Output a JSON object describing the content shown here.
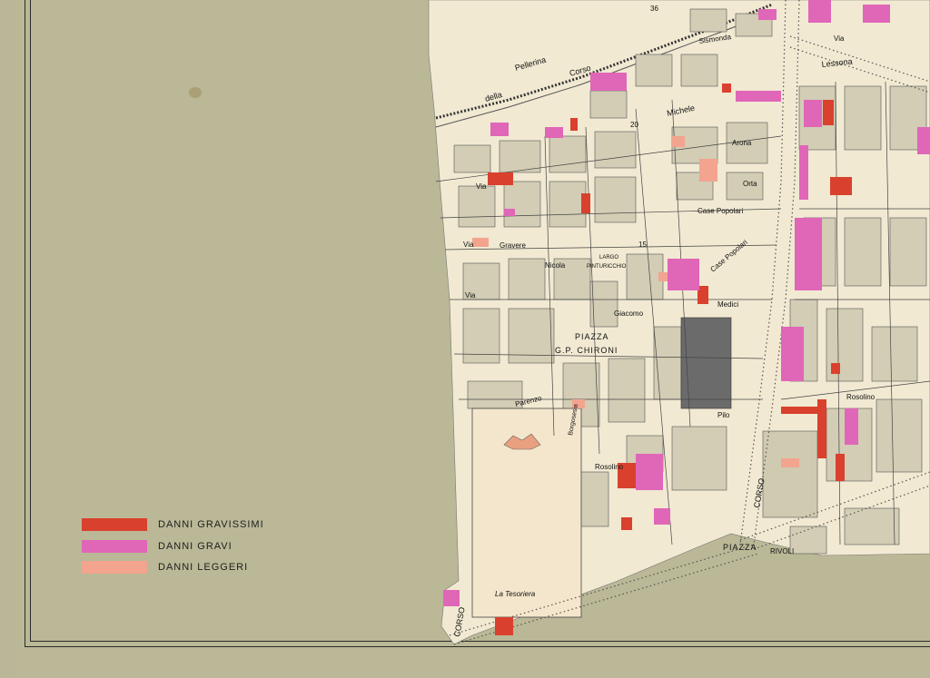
{
  "legend": {
    "items": [
      {
        "label": "DANNI  GRAVISSIMI",
        "color": "#d9412e"
      },
      {
        "label": "DANNI  GRAVI",
        "color": "#e066b8"
      },
      {
        "label": "DANNI  LEGGERI",
        "color": "#f2a48f"
      }
    ]
  },
  "map": {
    "colors": {
      "paper": "#bab896",
      "map_base": "#f1e9d2",
      "block": "#d2cdb4",
      "gravissimi": "#d9412e",
      "gravi": "#e066b8",
      "leggeri": "#f2a48f"
    },
    "labels": {
      "corso_top": "Corso",
      "pellerina": "Pellerina",
      "della": "della",
      "corso_left": "Corso",
      "michele": "Michele",
      "sismonda": "Sismonda",
      "lessona": "Lessona",
      "via_top_right": "Via",
      "piazza_chironi": "PIAZZA",
      "chironi": "G.P. CHIRONI",
      "largo": "LARGO",
      "pinturicchio": "PINTURICCHIO",
      "giacomo": "Giacomo",
      "medici": "Medici",
      "case_popolari_1": "Case Popolari",
      "case_popolari_2": "Case Popolari",
      "orta": "Orta",
      "arona": "Arona",
      "nicola": "Nicola",
      "gravere": "Gravere",
      "via_1": "Via",
      "via_2": "Via",
      "via_3": "Via",
      "rosolino_left": "Rosolino",
      "rosolino_right": "Rosolino",
      "pilo": "Pilo",
      "corso_vertical": "CORSO",
      "piazza_bottom": "PIAZZA",
      "rivoli": "RIVOLI",
      "corso_bottom_left": "CORSO",
      "la_tesoriera": "La Tesoriera",
      "parenzo": "Parenzo",
      "borgosesia": "Borgosesia",
      "num_20": "20",
      "num_15": "15",
      "num_36": "36"
    }
  }
}
